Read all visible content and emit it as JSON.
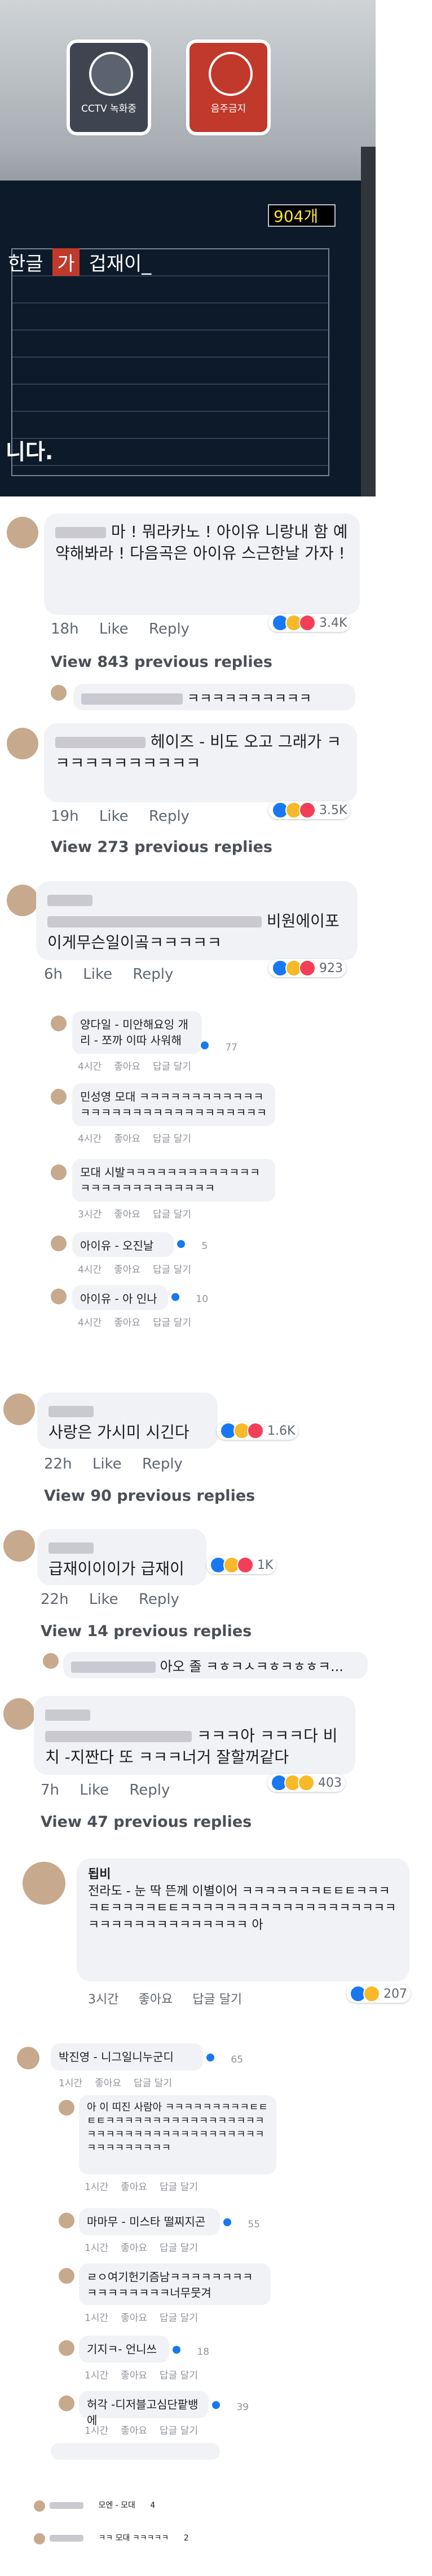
{
  "photo": {
    "signs": [
      {
        "label": "CCTV 녹화중",
        "icon": "cctv-icon"
      },
      {
        "label": "음주금지",
        "icon": "no-drinking-icon"
      }
    ],
    "counter": "904개",
    "title_prefix": "한글",
    "title_chip": "가",
    "title_suffix": "겁재이_",
    "bottom_text": "니다."
  },
  "comments": [
    {
      "text": "마 ! 뭐라카노 ! 아이유 니랑내 함 예약해봐라 ! 다음곡은 아이유 스근한날 가자 !",
      "time": "18h",
      "like": "Like",
      "reply": "Reply",
      "reactions": "3.4K",
      "prev": "View 843 previous replies",
      "preview": "ㅋㅋㅋㅋㅋㅋㅋㅋㅋㅋ"
    },
    {
      "text": "헤이즈 - 비도 오고 그래가 ㅋㅋㅋㅋㅋㅋㅋㅋㅋㅋㅋ",
      "time": "19h",
      "like": "Like",
      "reply": "Reply",
      "reactions": "3.5K",
      "prev": "View 273 previous replies"
    },
    {
      "text": "비원에이포 이게무슨일이곸ㅋㅋㅋㅋㅋ",
      "time": "6h",
      "like": "Like",
      "reply": "Reply",
      "reactions": "923"
    },
    {
      "text": "사랑은 가시미 시긴다",
      "time": "22h",
      "like": "Like",
      "reply": "Reply",
      "reactions": "1.6K",
      "prev": "View 90 previous replies"
    },
    {
      "text": "급재이이이가 급재이",
      "time": "22h",
      "like": "Like",
      "reply": "Reply",
      "reactions": "1K",
      "prev": "View 14 previous replies",
      "preview": "아오 졸 ㅋㅎㅋㅅㅋㅎㅋㅎㅎㅋ..."
    },
    {
      "text": "ㅋㅋㅋ아 ㅋㅋㅋ다 비치 -지짠다 또 ㅋㅋㅋ너거 잘할꺼같다",
      "time": "7h",
      "like": "Like",
      "reply": "Reply",
      "reactions": "403",
      "prev": "View 47 previous replies"
    },
    {
      "name": "됩비",
      "text": "전라도 - 눈 딱 뜬께 이별이어 ㅋㅋㅋㅋㅋㅋㅋㅌㅌㅌㅋㅋㅋㅋㅌㅋㅋㅋㅋㅌㅌㅋㅋㅋㅋㅋㅋㅋㅋㅋㅋㅋㅋㅋㅋㅋㅋㅋㅋㅋㅋㅋㅋㅋㅋㅋㅋㅋㅋㅋㅋㅋㅋㅋ 아",
      "time": "3시간",
      "like": "좋아요",
      "reply": "답글 달기",
      "reactions": "207"
    }
  ],
  "replies_a": [
    {
      "text": "양다일 - 미안해요잉 개리 - 쪼까 이따 사워해",
      "meta": [
        "4시간",
        "좋아요",
        "답글 달기"
      ],
      "count": "77"
    },
    {
      "text": "민성영 모대 ㅋㅋㅋㅋㅋㅋㅋㅋㅋㅋㅋㅋㅋㅋㅋㅋㅋㅋㅋㅋㅋㅋㅋㅋㅋㅋㅋㅋㅋㅋ",
      "meta": [
        "4시간",
        "좋아요",
        "답글 달기"
      ]
    },
    {
      "text": "모대 시발ㅋㅋㅋㅋㅋㅋㅋㅋㅋㅋㅋㅋㅋㅋㅋㅋㅋㅋㅋㅋㅋㅋㅋㅋㅋㅋ",
      "meta": [
        "3시간",
        "좋아요",
        "답글 달기"
      ]
    },
    {
      "text": "아이유 - 오진날",
      "meta": [
        "4시간",
        "좋아요",
        "답글 달기"
      ],
      "count": "5"
    },
    {
      "text": "아이유 - 아 인나",
      "meta": [
        "4시간",
        "좋아요",
        "답글 달기"
      ],
      "count": "10"
    }
  ],
  "replies_b": [
    {
      "text": "박진영 - 니그일니누군디",
      "meta": [
        "1시간",
        "좋아요",
        "답글 달기"
      ],
      "count": "65"
    },
    {
      "text": "아 이 띠진 사람아 ㅋㅋㅋㅋㅋㅋㅋㅋㅋㅌㅌㅌㅌㅋㅋㅋㅋㅋㅋㅋㅋㅋㅋㅋㅋㅋㅋㅋㅋㅋㅋㅋㅋㅋㅋㅋㅋㅋㅋㅋㅋㅋㅋㅋㅋㅋㅋㅋㅋㅋㅋㅋㅋㅋㅋㅋㅋㅋ",
      "meta": [
        "1시간",
        "좋아요",
        "답글 달기"
      ]
    },
    {
      "text": "마마무 - 미스타 떨찌지곤",
      "meta": [
        "1시간",
        "좋아요",
        "답글 달기"
      ],
      "count": "55"
    },
    {
      "text": "ㄹㅇ여기헌기즘남ㅋㅋㅋㅋㅋㅋㅋㅋㅋㅋㅋㅋㅋㅋㅋㅋ너무뭇겨",
      "meta": [
        "1시간",
        "좋아요",
        "답글 달기"
      ]
    },
    {
      "text": "기지ㅋ- 언니쓰",
      "meta": [
        "1시간",
        "좋아요",
        "답글 달기"
      ],
      "count": "18"
    },
    {
      "text": "허각 -디저블고심단팥뱅에",
      "meta": [
        "1시간",
        "좋아요",
        "답글 달기"
      ],
      "count": "39"
    }
  ],
  "tail": [
    {
      "text": "모엔 - 모대",
      "count": "4"
    },
    {
      "text": "ㅋㅋ 모대 ㅋㅋㅋㅋㅋ",
      "count": "2"
    }
  ]
}
